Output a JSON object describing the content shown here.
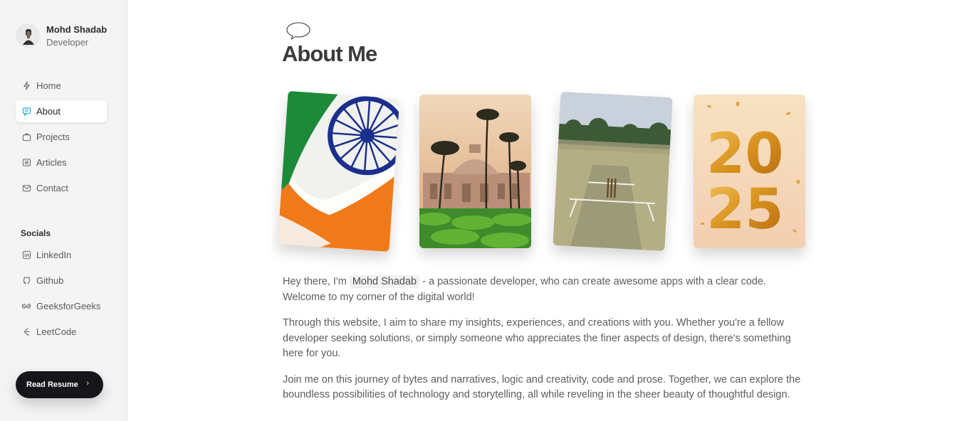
{
  "profile": {
    "name": "Mohd Shadab",
    "role": "Developer"
  },
  "nav": {
    "items": [
      {
        "label": "Home",
        "icon": "lightning-icon",
        "active": false
      },
      {
        "label": "About",
        "icon": "chat-icon",
        "active": true
      },
      {
        "label": "Projects",
        "icon": "briefcase-icon",
        "active": false
      },
      {
        "label": "Articles",
        "icon": "document-icon",
        "active": false
      },
      {
        "label": "Contact",
        "icon": "mail-icon",
        "active": false
      }
    ]
  },
  "socials": {
    "title": "Socials",
    "items": [
      {
        "label": "LinkedIn",
        "icon": "linkedin-icon"
      },
      {
        "label": "Github",
        "icon": "github-icon"
      },
      {
        "label": "GeeksforGeeks",
        "icon": "geeksforgeeks-icon"
      },
      {
        "label": "LeetCode",
        "icon": "leetcode-icon"
      }
    ]
  },
  "resume_button": {
    "label": "Read Resume",
    "chevron": "›"
  },
  "page": {
    "title": "About Me",
    "photos": [
      "indian-flag-photo",
      "tomb-with-palms-photo",
      "cricket-pitch-photo",
      "year-2025-photo"
    ],
    "paragraphs": [
      {
        "before": "Hey there, I'm ",
        "highlight": "Mohd Shadab",
        "after": " - a passionate developer, who can create awesome apps with a clear code. Welcome to my corner of the digital world!"
      },
      {
        "text": "Through this website, I aim to share my insights, experiences, and creations with you. Whether you're a fellow developer seeking solutions, or simply someone who appreciates the finer aspects of design, there's something here for you."
      },
      {
        "text": "Join me on this journey of bytes and narratives, logic and creativity, code and prose. Together, we can explore the boundless possibilities of technology and storytelling, all while reveling in the sheer beauty of thoughtful design."
      }
    ]
  },
  "colors": {
    "sidebar_bg": "#f4f4f5",
    "active_icon": "#1aa7d0",
    "button_bg": "#15161b"
  }
}
